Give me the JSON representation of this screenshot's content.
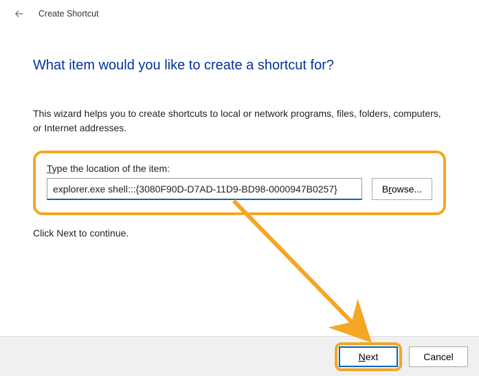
{
  "header": {
    "title": "Create Shortcut"
  },
  "main": {
    "heading": "What item would you like to create a shortcut for?",
    "description": "This wizard helps you to create shortcuts to local or network programs, files, folders, computers, or Internet addresses.",
    "field_label_prefix": "T",
    "field_label_rest": "ype the location of the item:",
    "location_value": "explorer.exe shell:::{3080F90D-D7AD-11D9-BD98-0000947B0257}",
    "browse_prefix": "B",
    "browse_underline": "r",
    "browse_rest": "owse...",
    "continue_text": "Click Next to continue."
  },
  "footer": {
    "next_underline": "N",
    "next_rest": "ext",
    "cancel": "Cancel"
  },
  "annotation": {
    "highlight_color": "#f5a623"
  }
}
